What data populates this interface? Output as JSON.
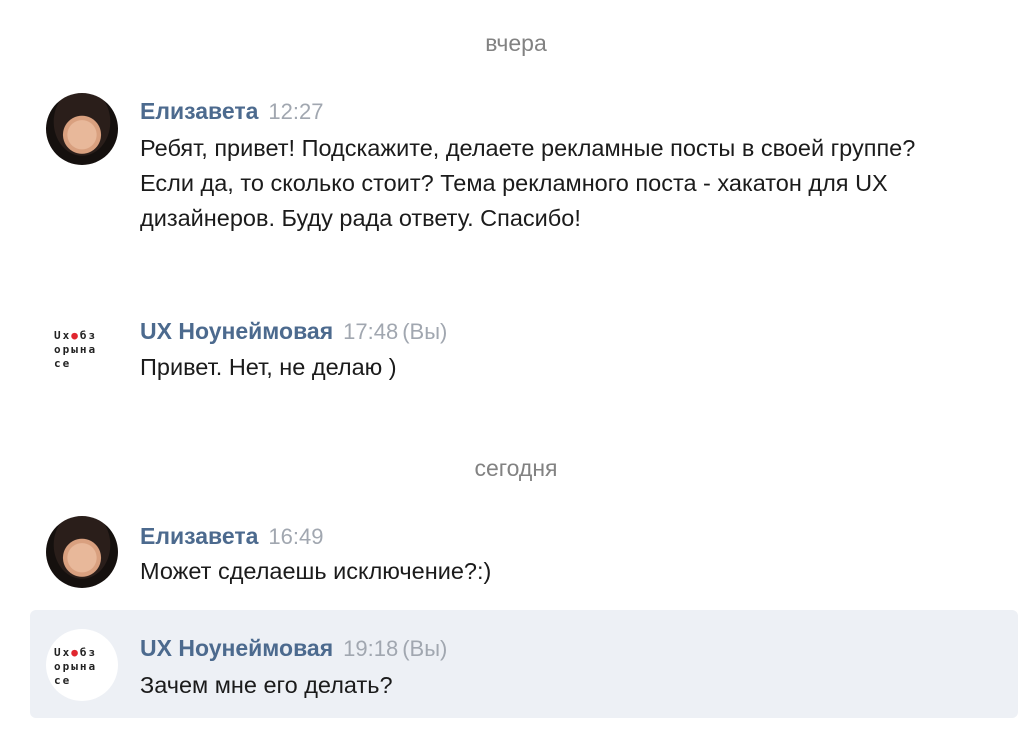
{
  "dividers": {
    "yesterday": "вчера",
    "today": "сегодня"
  },
  "messages": [
    {
      "author": "Елизавета",
      "time": "12:27",
      "you_label": "",
      "text": "Ребят, привет! Подскажите, делаете рекламные посты в своей группе? Если да, то сколько стоит? Тема рекламного поста - хакатон для UX дизайнеров. Буду рада ответу. Спасибо!",
      "avatar": "user-photo"
    },
    {
      "author": "UX Ноунеймовая",
      "time": "17:48",
      "you_label": "(Вы)",
      "text": "Привет. Нет, не делаю )",
      "avatar": "group-logo"
    },
    {
      "author": "Елизавета",
      "time": "16:49",
      "you_label": "",
      "text": "Может сделаешь исключение?:)",
      "avatar": "user-photo"
    },
    {
      "author": "UX Ноунеймовая",
      "time": "19:18",
      "you_label": "(Вы)",
      "text": "Зачем мне его делать?",
      "avatar": "group-logo",
      "highlighted": true
    }
  ],
  "logo_lines": [
    "Ux●бз",
    "орына",
    "сe"
  ],
  "colors": {
    "author_name": "#4c6a8e",
    "meta_gray": "#a1a7b0",
    "divider_gray": "#828282",
    "highlight_bg": "#edf0f5",
    "logo_dot": "#e0262f"
  }
}
